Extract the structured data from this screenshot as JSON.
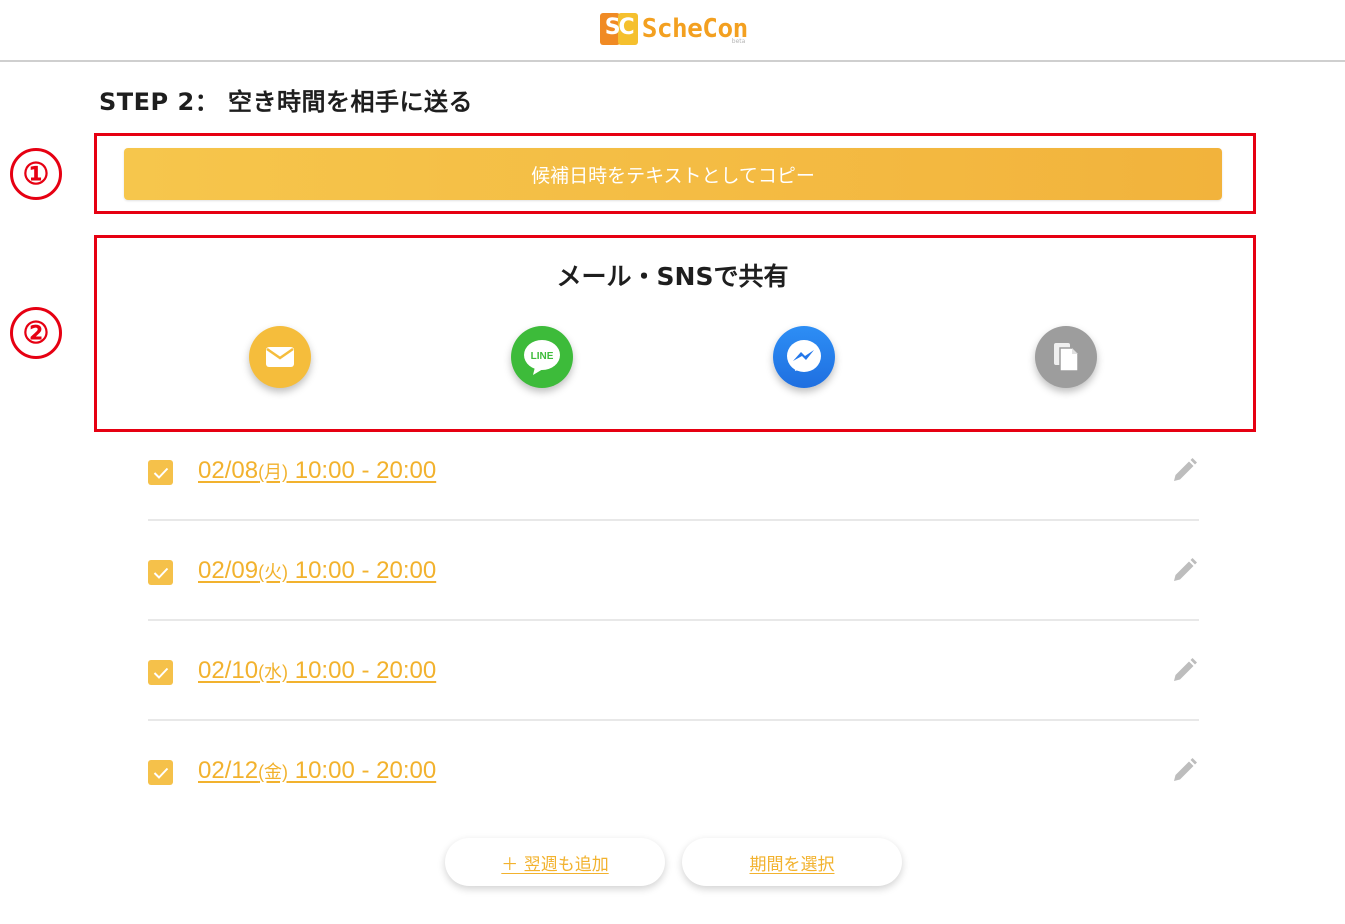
{
  "header": {
    "logo_mark": "SC",
    "logo_text": "ScheCon",
    "logo_beta": "beta"
  },
  "step": {
    "title": "STEP 2： 空き時間を相手に送る"
  },
  "annotations": {
    "one": "①",
    "two": "②",
    "color": "#e60012"
  },
  "copy_button": {
    "label": "候補日時をテキストとしてコピー"
  },
  "share": {
    "title": "メール・SNSで共有",
    "icons": [
      {
        "name": "mail-icon",
        "color": "#f5bd3c"
      },
      {
        "name": "line-icon",
        "color": "#3dbb3a",
        "text": "LINE"
      },
      {
        "name": "messenger-icon",
        "color": "#2d8ef5"
      },
      {
        "name": "copy-icon",
        "color": "#9d9d9d"
      }
    ]
  },
  "slots": [
    {
      "date": "02/08",
      "dow": "(月)",
      "time": " 10:00 - 20:00",
      "checked": true
    },
    {
      "date": "02/09",
      "dow": "(火)",
      "time": " 10:00 - 20:00",
      "checked": true
    },
    {
      "date": "02/10",
      "dow": "(水)",
      "time": " 10:00 - 20:00",
      "checked": true
    },
    {
      "date": "02/12",
      "dow": "(金)",
      "time": " 10:00 - 20:00",
      "checked": true
    }
  ],
  "buttons": {
    "add_next_week": "＋ 翌週も追加",
    "select_period": "期間を選択"
  },
  "colors": {
    "accent": "#f2b22e",
    "accent_light": "#f6c64c"
  }
}
